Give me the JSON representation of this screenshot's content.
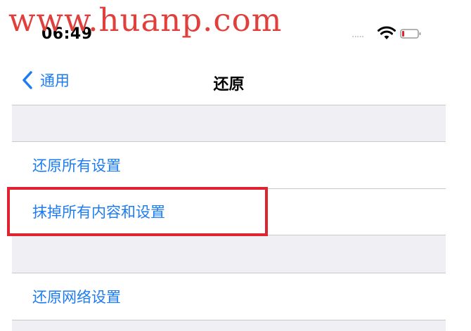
{
  "watermark": "www.huanp.com",
  "status_bar": {
    "time": "06:49",
    "signal": ".....",
    "icons": [
      "wifi-icon",
      "battery-icon"
    ]
  },
  "nav": {
    "back_label": "通用",
    "title": "还原"
  },
  "groups": [
    {
      "rows": [
        "还原所有设置",
        "抹掉所有内容和设置"
      ]
    },
    {
      "rows": [
        "还原网络设置"
      ]
    }
  ],
  "highlighted_row": "抹掉所有内容和设置",
  "colors": {
    "link_blue": "#1d7cf2",
    "highlight_red": "#e0242f",
    "watermark_red": "#e0403c",
    "group_background": "#efeff4"
  }
}
